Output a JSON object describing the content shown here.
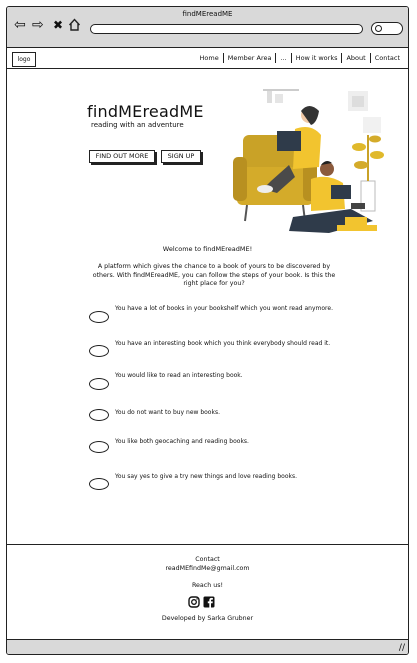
{
  "window": {
    "title": "findMEreadME"
  },
  "browser": {
    "back_icon": "arrow-left-icon",
    "forward_icon": "arrow-right-icon",
    "close_icon": "x-icon",
    "home_icon": "home-icon",
    "url": "",
    "search_icon": "search-icon"
  },
  "header": {
    "logo": "logo",
    "menu": [
      "Home",
      "Member Area",
      "...",
      "How it works",
      "About",
      "Contact"
    ]
  },
  "hero": {
    "title": "findMEreadME",
    "tagline": "reading with an adventure",
    "find_out_more": "FIND OUT MORE",
    "sign_up": "SIGN UP"
  },
  "main": {
    "welcome": "Welcome to findMEreadME!",
    "lead": "A platform which gives the chance to a book of yours to be discovered by others. With findMEreadME, you can follow the steps of your book. Is this the right place for you?",
    "choices": [
      "You have a lot of books in your bookshelf which you wont read anymore.",
      "You have an interesting book which you think everybody should read it.",
      "You would like to read an interesting book.",
      "You do not want to buy new books.",
      "You like both geocaching and reading books.",
      "You say yes to give a try new things and love reading books."
    ]
  },
  "footer": {
    "contact_label": "Contact",
    "email": "readMEfindMe@gmail.com",
    "reach_us": "Reach us!",
    "developed_by": "Developed by Sarka Grubner",
    "social_icons": [
      "instagram-icon",
      "facebook-icon"
    ]
  },
  "colors": {
    "accent": "#f2c42f",
    "chrome": "#d9d9d9",
    "ink": "#222222"
  }
}
